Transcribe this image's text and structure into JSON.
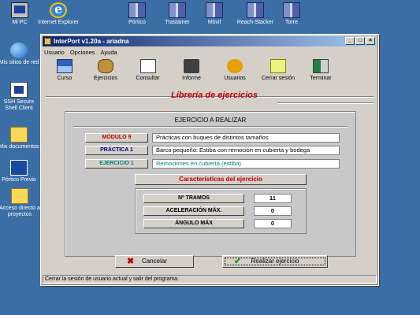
{
  "desktop": {
    "icons": [
      {
        "label": "Mi PC",
        "icon": "my-computer-icon"
      },
      {
        "label": "Internet Explorer",
        "icon": "internet-explorer-icon"
      },
      {
        "label": "Pórtico",
        "icon": "crane-building-icon"
      },
      {
        "label": "Trastainer",
        "icon": "crane-building-icon"
      },
      {
        "label": "Móvil",
        "icon": "crane-building-icon"
      },
      {
        "label": "Reach-Stacker",
        "icon": "crane-building-icon"
      },
      {
        "label": "Torre",
        "icon": "crane-building-icon"
      },
      {
        "label": "Mis sitios de red",
        "icon": "network-globe-icon"
      },
      {
        "label": "SSH Secure Shell Client",
        "icon": "ssh-client-icon"
      },
      {
        "label": "Mis documentos",
        "icon": "folder-icon"
      },
      {
        "label": "Pórtico Previo",
        "icon": "portico-app-icon"
      },
      {
        "label": "Acceso directo a proyectos",
        "icon": "folder-icon"
      }
    ]
  },
  "window": {
    "title": "InterPort v1.20a - ariadna",
    "controls": {
      "minimize": "_",
      "maximize": "□",
      "close": "×"
    },
    "menu": [
      "Usuario",
      "Opciones",
      "Ayuda"
    ],
    "toolbar": [
      {
        "label": "Curso",
        "icon": "course-book-icon"
      },
      {
        "label": "Ejercicios",
        "icon": "exercises-icon"
      },
      {
        "label": "Consultar",
        "icon": "consult-printer-icon"
      },
      {
        "label": "Informe",
        "icon": "report-typewriter-icon"
      },
      {
        "label": "Usuarios",
        "icon": "users-icon"
      },
      {
        "label": "Cerrar sesión",
        "icon": "logout-key-icon"
      },
      {
        "label": "Terminar",
        "icon": "exit-door-icon"
      }
    ],
    "section_title": "Librería de ejercicios",
    "exercise": {
      "heading": "EJERCICIO A REALIZAR",
      "modulo_label": "MÓDULO 9",
      "modulo_value": "Prácticas con buques de distintos tamaños",
      "practica_label": "PRÁCTICA 1",
      "practica_value": "Barco pequeño: Estiba con remoción en cubierta y bodega",
      "ejercicio_label": "EJERCICIO 1",
      "ejercicio_value": "Remociones en cubierta (estiba)"
    },
    "characteristics": {
      "title": "Características del ejercicio",
      "rows": [
        {
          "label": "Nº TRAMOS",
          "value": "11"
        },
        {
          "label": "ACELERACIÓN MÁX.",
          "value": "0"
        },
        {
          "label": "ÁNGULO MÁX",
          "value": "0"
        }
      ]
    },
    "buttons": {
      "cancel": "Cancelar",
      "run": "Realizar ejercicio"
    },
    "status": "Cerrar la sesión de usuario actual y salir del programa."
  }
}
